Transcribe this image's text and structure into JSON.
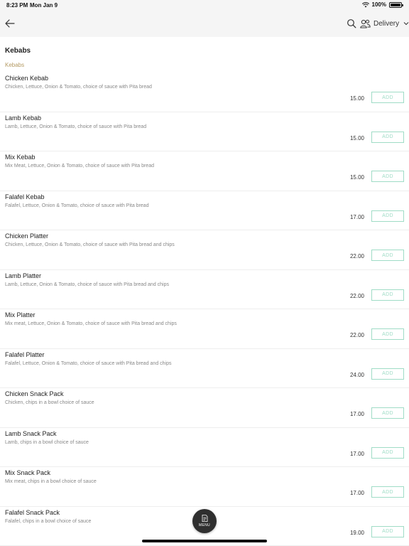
{
  "status_bar": {
    "time": "8:23 PM",
    "date": "Mon Jan 9",
    "battery": "100%"
  },
  "header": {
    "delivery_label": "Delivery",
    "icons": [
      "back-arrow-icon",
      "search-icon",
      "people-icon",
      "chevron-down-icon"
    ]
  },
  "section": {
    "title": "Kebabs",
    "category": "Kebabs"
  },
  "add_label": "ADD",
  "items": [
    {
      "name": "Chicken Kebab",
      "desc": "Chicken, Lettuce, Onion & Tomato, choice of sauce with Pita bread",
      "price": "15.00"
    },
    {
      "name": "Lamb Kebab",
      "desc": "Lamb, Lettuce, Onion & Tomato, choice of sauce with Pita bread",
      "price": "15.00"
    },
    {
      "name": "Mix Kebab",
      "desc": "Mix Meat, Lettuce, Onion & Tomato, choice of sauce with Pita bread",
      "price": "15.00"
    },
    {
      "name": "Falafel Kebab",
      "desc": "Falafel, Lettuce, Onion & Tomato, choice of sauce with Pita bread",
      "price": "17.00"
    },
    {
      "name": "Chicken Platter",
      "desc": "Chicken, Lettuce, Onion & Tomato, choice of sauce with Pita bread and chips",
      "price": "22.00"
    },
    {
      "name": "Lamb Platter",
      "desc": "Lamb, Lettuce, Onion & Tomato, choice of sauce with Pita bread and chips",
      "price": "22.00"
    },
    {
      "name": "Mix Platter",
      "desc": "Mix meat, Lettuce, Onion & Tomato, choice of sauce with Pita bread and chips",
      "price": "22.00"
    },
    {
      "name": "Falafel Platter",
      "desc": "Falafel, Lettuce, Onion & Tomato, choice of sauce with Pita bread and chips",
      "price": "24.00"
    },
    {
      "name": "Chicken Snack Pack",
      "desc": "Chicken, chips in a bowl choice of sauce",
      "price": "17.00"
    },
    {
      "name": "Lamb Snack Pack",
      "desc": "Lamb, chips in a bowl choice of sauce",
      "price": "17.00"
    },
    {
      "name": "Mix Snack Pack",
      "desc": "Mix meat, chips in a bowl choice of sauce",
      "price": "17.00"
    },
    {
      "name": "Falafel Snack Pack",
      "desc": "Falafel, chips in a bowl choice of sauce",
      "price": "19.00"
    }
  ],
  "menu_button": {
    "label": "MENU",
    "icon": "document-icon"
  },
  "colors": {
    "accent_gold": "#b49a63",
    "add_button": "#9fdcc6",
    "fab": "#2f2f2f"
  }
}
